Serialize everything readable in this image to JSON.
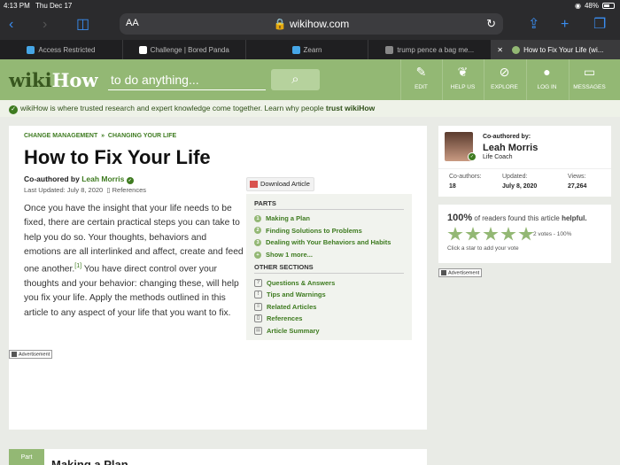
{
  "status": {
    "time": "4:13 PM",
    "date": "Thu Dec 17",
    "battery": "48%"
  },
  "browser": {
    "aa": "AA",
    "url": "wikihow.com",
    "tabs": [
      {
        "label": "Access Restricted",
        "fav_color": "#46a6e6"
      },
      {
        "label": "Challenge | Bored Panda",
        "fav_color": "#ffffff"
      },
      {
        "label": "Zearn",
        "fav_color": "#46a6e6"
      },
      {
        "label": "trump pence a bag me...",
        "fav_color": "#888888"
      },
      {
        "label": "How to Fix Your Life (wi...",
        "fav_color": "#93b874"
      }
    ]
  },
  "header": {
    "logo_a": "wiki",
    "logo_b": "How",
    "search_placeholder": "to do anything...",
    "nav": [
      {
        "label": "EDIT",
        "icon": "✎"
      },
      {
        "label": "HELP US",
        "icon": "❦"
      },
      {
        "label": "EXPLORE",
        "icon": "⊘"
      },
      {
        "label": "LOG IN",
        "icon": "●"
      },
      {
        "label": "MESSAGES",
        "icon": "▭"
      }
    ],
    "trust_text": "wikiHow is where trusted research and expert knowledge come together. Learn why people ",
    "trust_link": "trust wikiHow"
  },
  "article": {
    "crumb1": "CHANGE MANAGEMENT",
    "crumb_sep": "»",
    "crumb2": "CHANGING YOUR LIFE",
    "title": "How to Fix Your Life",
    "coauth_prefix": "Co-authored by",
    "coauth_name": "Leah Morris",
    "updated": "Last Updated: July 8, 2020",
    "references": "References",
    "intro_a": "Once you have the insight that your life needs to be fixed, there are certain practical steps you can take to help you do so. Your thoughts, behaviors and emotions are all interlinked and affect, create and feed one another.",
    "intro_sup": "[1]",
    "intro_b": " You have direct control over your thoughts and your behavior: changing these, will help you fix your life. Apply the methods outlined in this article to any aspect of your life that you want to fix.",
    "download": "Download Article",
    "ad": "Advertisement",
    "part_label": "Part",
    "part_title": "Making a Plan"
  },
  "toc": {
    "parts_heading": "PARTS",
    "parts": [
      {
        "num": "1",
        "label": "Making a Plan"
      },
      {
        "num": "2",
        "label": "Finding Solutions to Problems"
      },
      {
        "num": "3",
        "label": "Dealing with Your Behaviors and Habits"
      },
      {
        "num": "+",
        "label": "Show 1 more..."
      }
    ],
    "other_heading": "OTHER SECTIONS",
    "other": [
      {
        "icon": "?",
        "label": "Questions & Answers"
      },
      {
        "icon": "!",
        "label": "Tips and Warnings"
      },
      {
        "icon": "≡",
        "label": "Related Articles"
      },
      {
        "icon": "▯",
        "label": "References"
      },
      {
        "icon": "☰",
        "label": "Article Summary"
      }
    ]
  },
  "author": {
    "label": "Co-authored by:",
    "name": "Leah Morris",
    "role": "Life Coach",
    "stats": [
      {
        "label": "Co-authors:",
        "value": "18"
      },
      {
        "label": "Updated:",
        "value": "July 8, 2020"
      },
      {
        "label": "Views:",
        "value": "27,264"
      }
    ]
  },
  "rating": {
    "pct": "100%",
    "text": " of readers found this article ",
    "helpful": "helpful.",
    "votes": "2 votes - 100%",
    "click": "Click a star to add your vote",
    "ad": "Advertisement"
  }
}
